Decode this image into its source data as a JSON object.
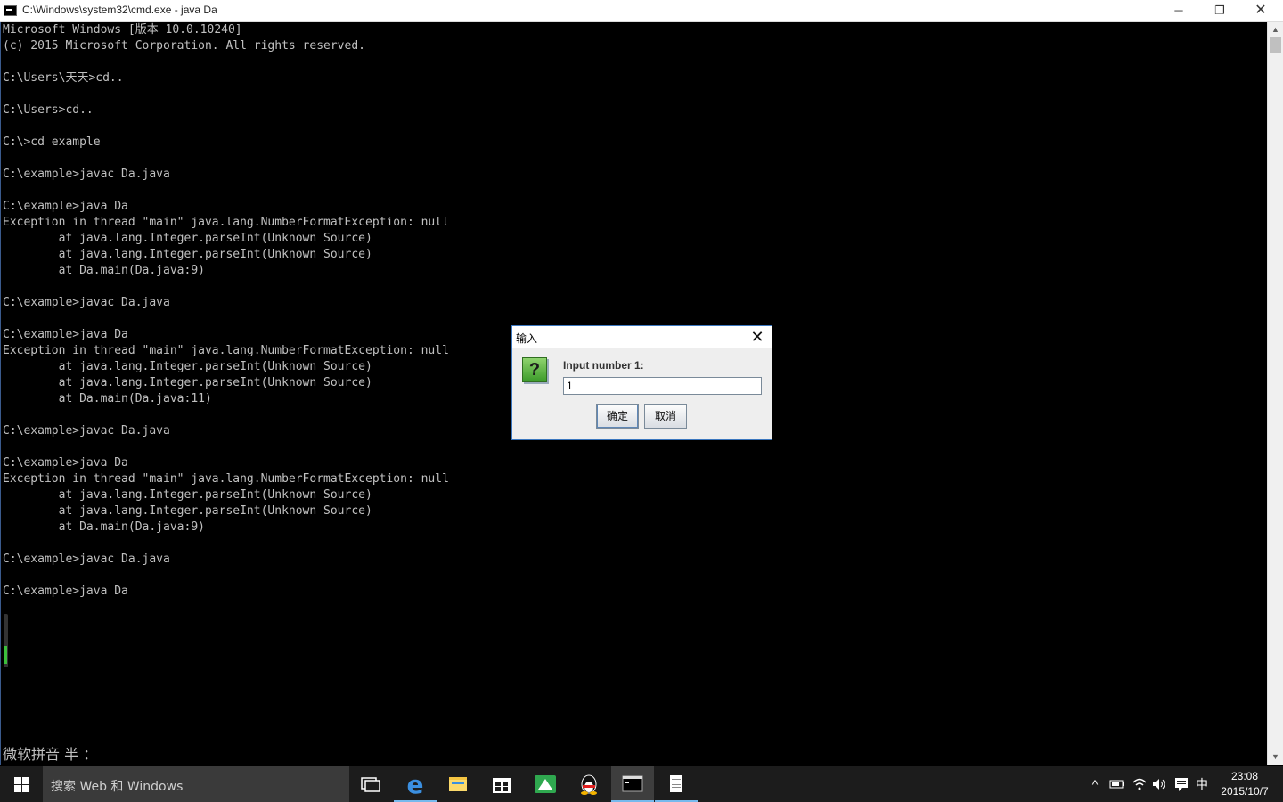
{
  "window": {
    "title": "C:\\Windows\\system32\\cmd.exe - java  Da",
    "minimize": "─",
    "maximize": "❐",
    "close": "✕"
  },
  "console": {
    "lines": [
      "Microsoft Windows [版本 10.0.10240]",
      "(c) 2015 Microsoft Corporation. All rights reserved.",
      "",
      "C:\\Users\\天天>cd..",
      "",
      "C:\\Users>cd..",
      "",
      "C:\\>cd example",
      "",
      "C:\\example>javac Da.java",
      "",
      "C:\\example>java Da",
      "Exception in thread \"main\" java.lang.NumberFormatException: null",
      "        at java.lang.Integer.parseInt(Unknown Source)",
      "        at java.lang.Integer.parseInt(Unknown Source)",
      "        at Da.main(Da.java:9)",
      "",
      "C:\\example>javac Da.java",
      "",
      "C:\\example>java Da",
      "Exception in thread \"main\" java.lang.NumberFormatException: null",
      "        at java.lang.Integer.parseInt(Unknown Source)",
      "        at java.lang.Integer.parseInt(Unknown Source)",
      "        at Da.main(Da.java:11)",
      "",
      "C:\\example>javac Da.java",
      "",
      "C:\\example>java Da",
      "Exception in thread \"main\" java.lang.NumberFormatException: null",
      "        at java.lang.Integer.parseInt(Unknown Source)",
      "        at java.lang.Integer.parseInt(Unknown Source)",
      "        at Da.main(Da.java:9)",
      "",
      "C:\\example>javac Da.java",
      "",
      "C:\\example>java Da"
    ],
    "ime_status": "微软拼音 半 ："
  },
  "dialog": {
    "title": "输入",
    "icon_glyph": "?",
    "label": "Input number 1:",
    "input_value": "1",
    "ok_label": "确定",
    "cancel_label": "取消"
  },
  "taskbar": {
    "search_placeholder": "搜索 Web 和 Windows",
    "items": [
      "task-view",
      "edge",
      "file-explorer",
      "store",
      "wechat-like-app",
      "qq",
      "cmd",
      "notepad"
    ],
    "tray": {
      "ime_lang": "中",
      "time": "23:08",
      "date": "2015/10/7"
    }
  },
  "colors": {
    "console_bg": "#000000",
    "console_text": "#c0c0c0",
    "taskbar_bg": "#1c1c1c",
    "accent": "#76b9ed"
  }
}
